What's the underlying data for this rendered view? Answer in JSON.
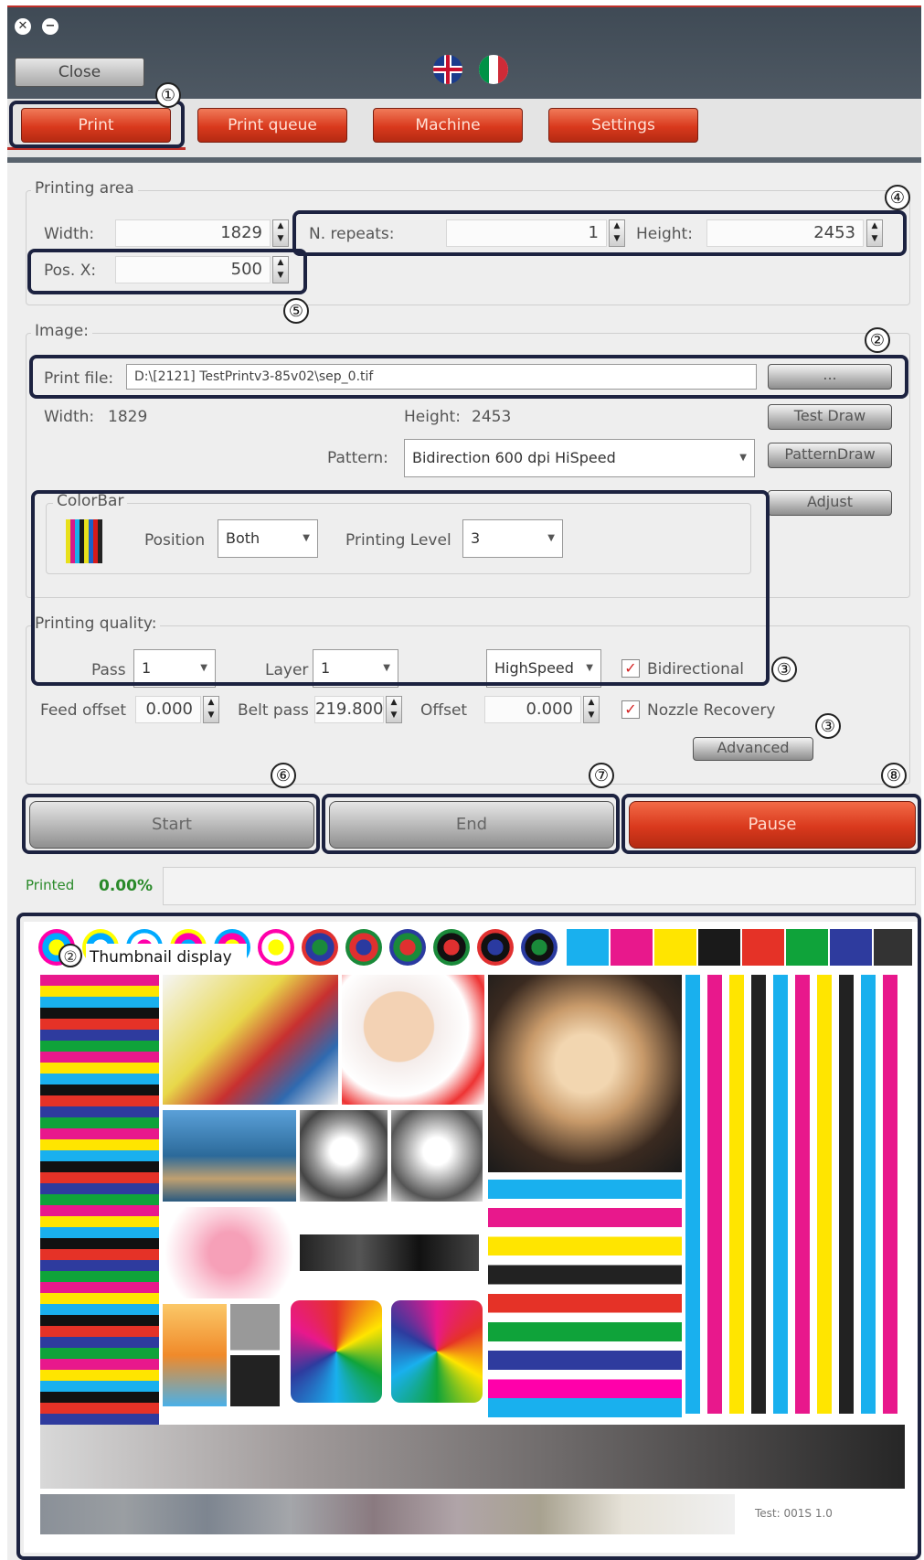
{
  "window_controls": {
    "close_glyph": "✕",
    "minimize_glyph": "−"
  },
  "toolbar": {
    "close_label": "Close"
  },
  "tabs": [
    {
      "label": "Print"
    },
    {
      "label": "Print queue"
    },
    {
      "label": "Machine"
    },
    {
      "label": "Settings"
    }
  ],
  "callouts": [
    "①",
    "②",
    "③",
    "④",
    "⑤",
    "⑥",
    "⑦",
    "⑧"
  ],
  "printing_area": {
    "title": "Printing area",
    "width_label": "Width:",
    "width_value": "1829",
    "repeats_label": "N. repeats:",
    "repeats_value": "1",
    "height_label": "Height:",
    "height_value": "2453",
    "posx_label": "Pos. X:",
    "posx_value": "500"
  },
  "image": {
    "title": "Image:",
    "print_file_label": "Print file:",
    "print_file_value": "D:\\[2121] TestPrintv3-85v02\\sep_0.tif",
    "browse_label": "...",
    "width_label": "Width:",
    "width_value": "1829",
    "height_label": "Height:",
    "height_value": "2453",
    "pattern_label": "Pattern:",
    "pattern_value": "Bidirection 600 dpi HiSpeed",
    "test_draw_label": "Test Draw",
    "pattern_draw_label": "PatternDraw",
    "adjust_label": "Adjust"
  },
  "colorbar": {
    "title": "ColorBar",
    "position_label": "Position",
    "position_value": "Both",
    "level_label": "Printing Level",
    "level_value": "3",
    "stripe_colors": [
      "#e8e01a",
      "#d61a8a",
      "#1ab0e8",
      "#1a1a1a",
      "#e8e01a",
      "#1a60c8",
      "#d61a1a",
      "#222222"
    ]
  },
  "quality": {
    "title": "Printing quality:",
    "pass_label": "Pass",
    "pass_value": "1",
    "layer_label": "Layer",
    "layer_value": "1",
    "speed_value": "HighSpeed",
    "bidirectional_label": "Bidirectional",
    "bidirectional_checked": true,
    "feed_offset_label": "Feed offset",
    "feed_offset_value": "0.000",
    "belt_pass_label": "Belt pass",
    "belt_pass_value": "219.800",
    "offset_label": "Offset",
    "offset_value": "0.000",
    "nozzle_label": "Nozzle Recovery",
    "nozzle_checked": true,
    "advanced_label": "Advanced"
  },
  "actions": {
    "start_label": "Start",
    "end_label": "End",
    "pause_label": "Pause"
  },
  "progress": {
    "label": "Printed",
    "percent_text": "0.00%",
    "fraction": 0.0
  },
  "thumbnail": {
    "caption": "Thumbnail display",
    "footer_text": "Test: 001S 1.0"
  },
  "colors": {
    "accent_red": "#d9391d",
    "frame": "#1c2240",
    "printed_green": "#2a8a2a"
  }
}
